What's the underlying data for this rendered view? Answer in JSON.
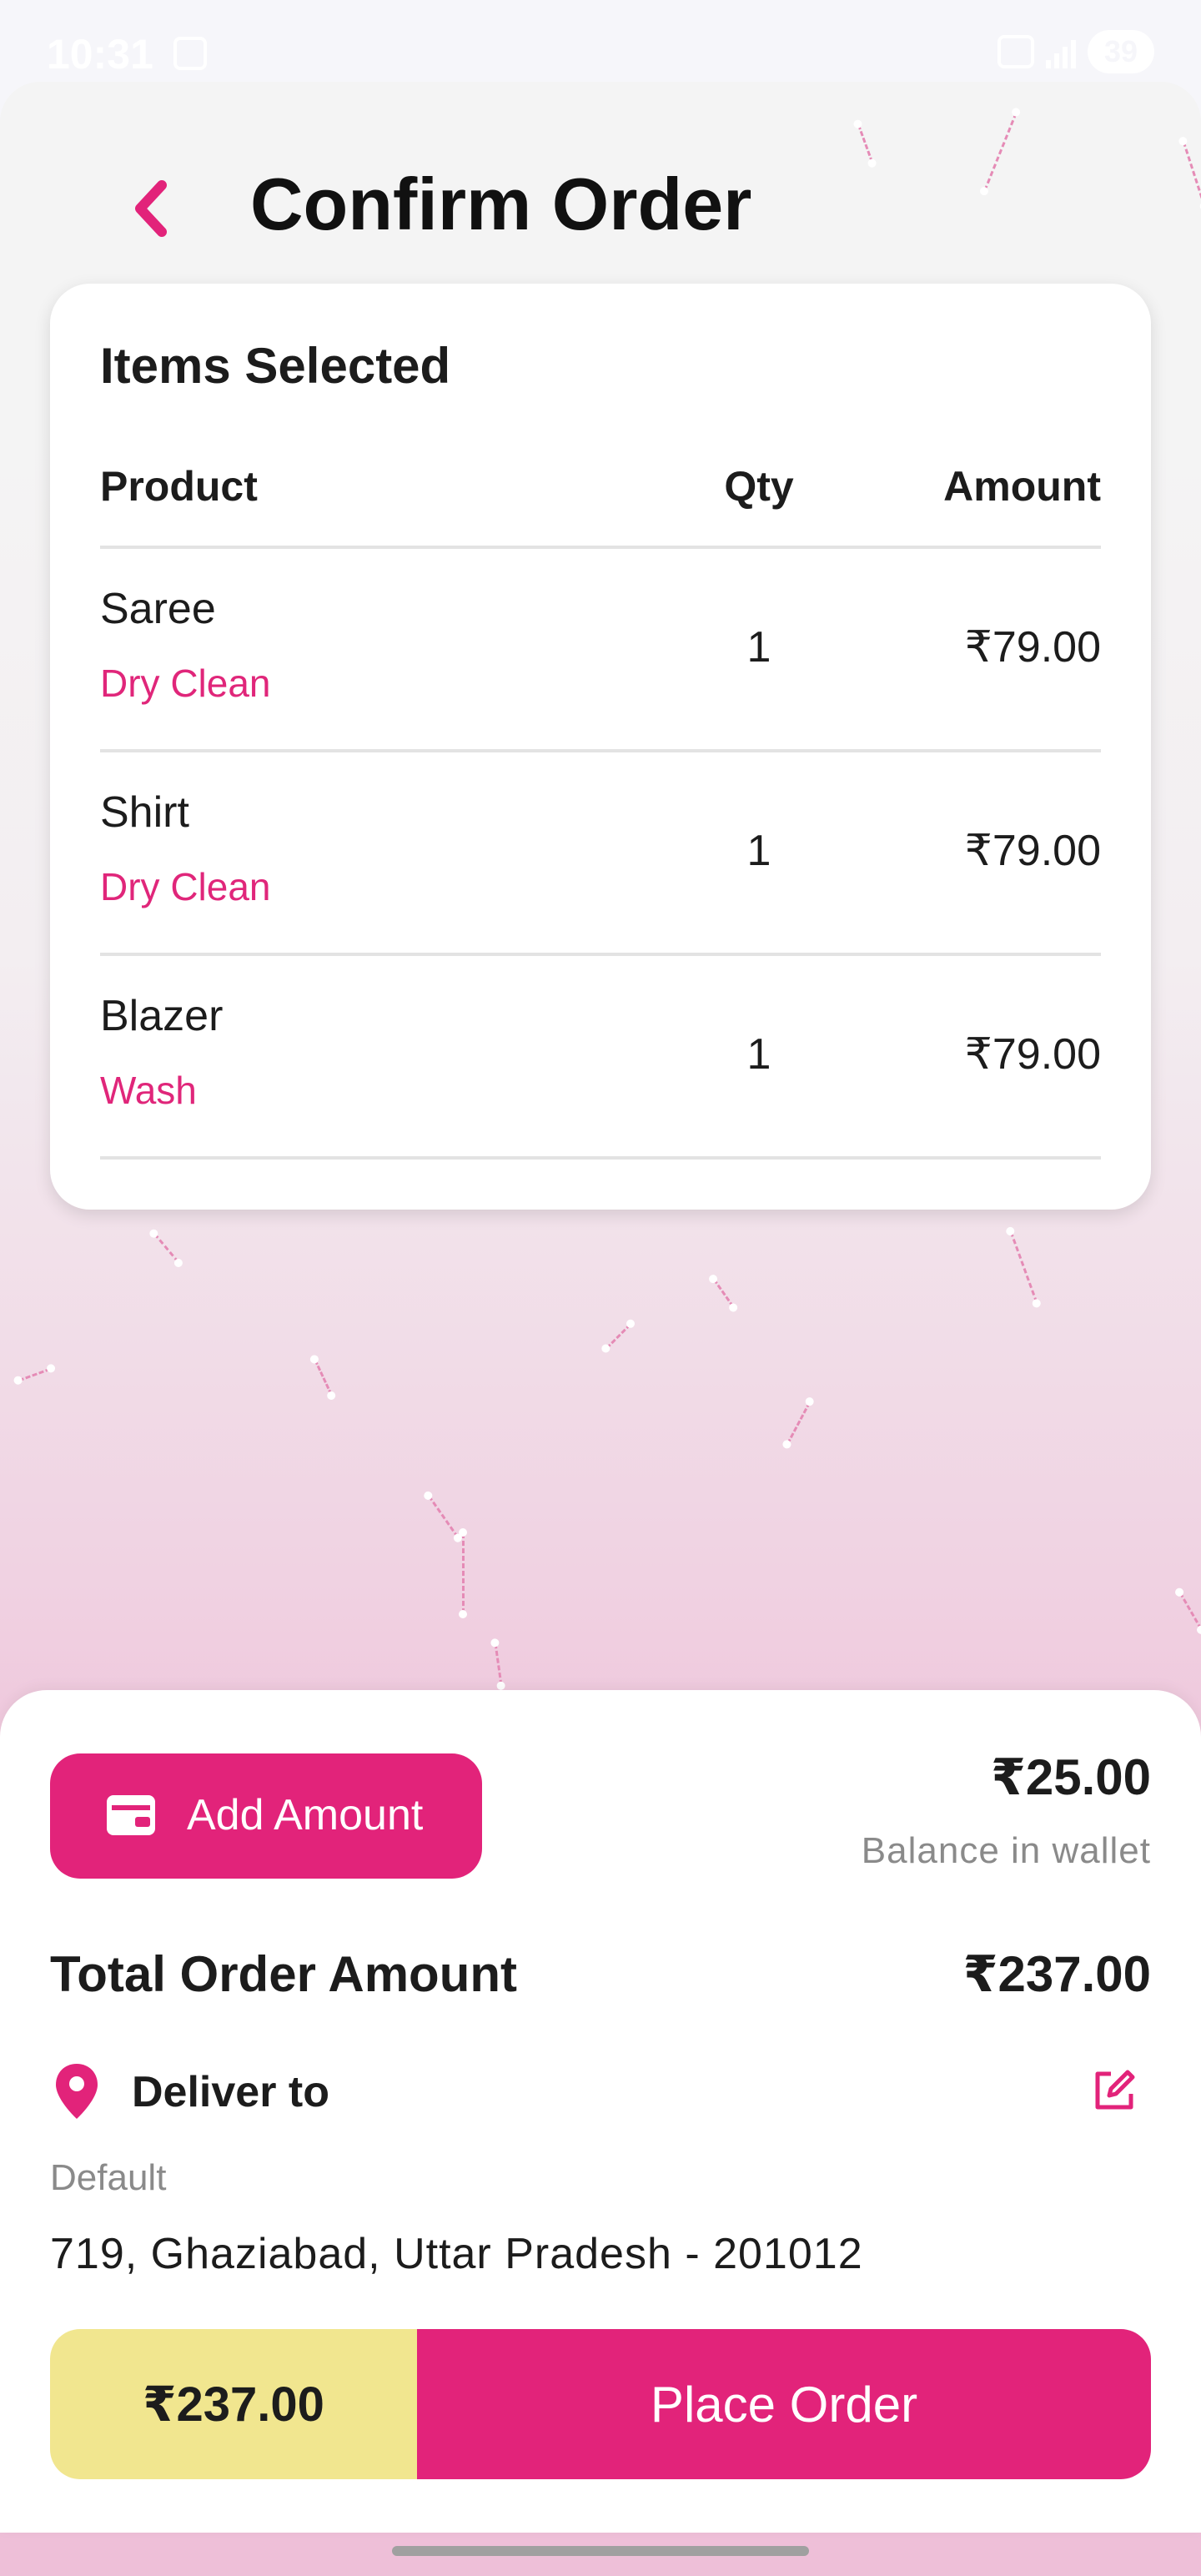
{
  "status_bar": {
    "time": "10:31",
    "battery": "39"
  },
  "header": {
    "title": "Confirm Order"
  },
  "items_card": {
    "title": "Items Selected",
    "columns": {
      "product": "Product",
      "qty": "Qty",
      "amount": "Amount"
    },
    "rows": [
      {
        "name": "Saree",
        "service": "Dry Clean",
        "qty": "1",
        "amount": "₹79.00"
      },
      {
        "name": "Shirt",
        "service": "Dry Clean",
        "qty": "1",
        "amount": "₹79.00"
      },
      {
        "name": "Blazer",
        "service": "Wash",
        "qty": "1",
        "amount": "₹79.00"
      }
    ]
  },
  "wallet": {
    "add_amount_label": "Add Amount",
    "balance": "₹25.00",
    "balance_caption": "Balance in wallet"
  },
  "total": {
    "label": "Total Order Amount",
    "value": "₹237.00"
  },
  "delivery": {
    "label": "Deliver to",
    "address_tag": "Default",
    "address": "719, Ghaziabad, Uttar Pradesh - 201012"
  },
  "order_bar": {
    "price": "₹237.00",
    "place_order_label": "Place Order"
  },
  "colors": {
    "accent": "#e2237a",
    "price_bar": "#f1e68f",
    "service_text": "#e0267a"
  },
  "icons": {
    "back": "chevron-left-icon",
    "wallet": "wallet-icon",
    "location": "location-pin-icon",
    "edit": "edit-icon"
  }
}
